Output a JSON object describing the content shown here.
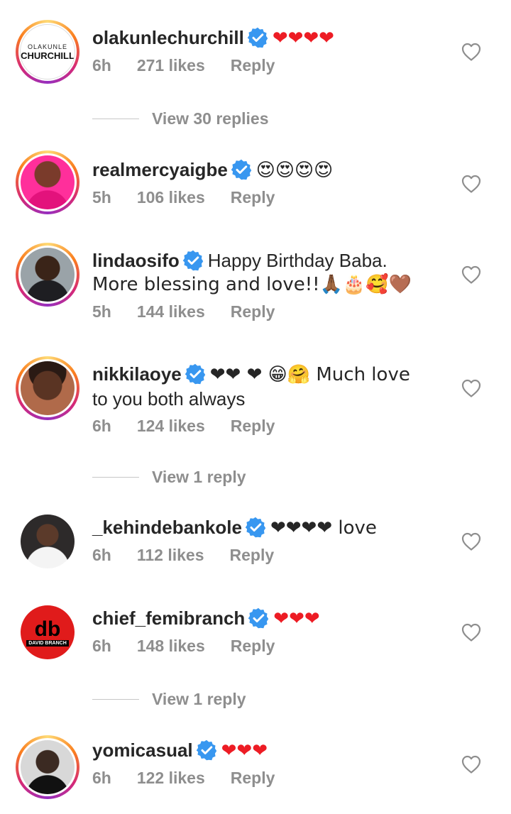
{
  "comments": [
    {
      "username": "olakunlechurchill",
      "text": "❤❤❤❤",
      "time": "6h",
      "likes": "271 likes",
      "reply": "Reply",
      "view_replies": "View 30 replies",
      "avatar_lines": [
        "OLAKUNLE",
        "CHURCHILL"
      ]
    },
    {
      "username": "realmercyaigbe",
      "text": "😍😍😍😍",
      "time": "5h",
      "likes": "106 likes",
      "reply": "Reply"
    },
    {
      "username": "lindaosifo",
      "text": "Happy Birthday Baba.",
      "text2": "More blessing and love!!🙏🏾🎂🥰🤎",
      "time": "5h",
      "likes": "144 likes",
      "reply": "Reply"
    },
    {
      "username": "nikkilaoye",
      "text": "❤❤ ❤ 😁🤗 Much love",
      "text2": "to you both always",
      "time": "6h",
      "likes": "124 likes",
      "reply": "Reply",
      "view_replies": "View 1 reply"
    },
    {
      "username": "_kehindebankole",
      "text": "❤❤❤❤ love",
      "time": "6h",
      "likes": "112 likes",
      "reply": "Reply"
    },
    {
      "username": "chief_femibranch",
      "text": "❤❤❤",
      "time": "6h",
      "likes": "148 likes",
      "reply": "Reply",
      "view_replies": "View 1 reply",
      "avatar_text": "DAVID BRANCH"
    },
    {
      "username": "yomicasual",
      "text": "❤❤❤",
      "time": "6h",
      "likes": "122 likes",
      "reply": "Reply"
    }
  ],
  "icons": {
    "verified": "verified-badge-icon",
    "like": "heart-outline-icon"
  },
  "colors": {
    "verified": "#3897f0",
    "meta": "#8e8e8e",
    "heart": "#ed1c24"
  }
}
